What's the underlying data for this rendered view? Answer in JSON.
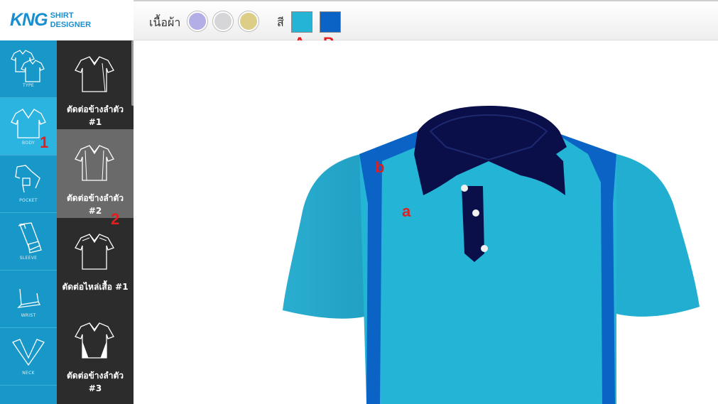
{
  "logo": {
    "mark": "KNG",
    "line1": "SHIRT",
    "line2": "DESIGNER"
  },
  "toolbar": {
    "fabric_label": "เนื้อผ้า",
    "fabric_swatches": [
      {
        "name": "purple",
        "color": "#b3aee6"
      },
      {
        "name": "grey",
        "color": "#d6d6d8"
      },
      {
        "name": "gold",
        "color": "#dcce86"
      }
    ],
    "color_label": "สี",
    "color_swatches": [
      {
        "marker": "A",
        "color": "#24b4d6"
      },
      {
        "marker": "B",
        "color": "#0b63c6"
      }
    ]
  },
  "categories": [
    {
      "label": "TYPE",
      "icon": "shirt-type-icon"
    },
    {
      "label": "BODY",
      "icon": "shirt-body-icon",
      "active": true,
      "marker": "1"
    },
    {
      "label": "POCKET",
      "icon": "pocket-icon"
    },
    {
      "label": "SLEEVE",
      "icon": "sleeve-icon"
    },
    {
      "label": "WRIST",
      "icon": "wrist-icon"
    },
    {
      "label": "NECK",
      "icon": "neck-icon"
    }
  ],
  "options": [
    {
      "line1": "ตัดต่อข้างลำตัว",
      "line2": "#1"
    },
    {
      "line1": "ตัดต่อข้างลำตัว",
      "line2": "#2",
      "active": true,
      "marker": "2"
    },
    {
      "line1": "ตัดต่อไหล่เสื้อ #1",
      "line2": ""
    },
    {
      "line1": "ตัดต่อข้างลำตัว",
      "line2": "#3"
    }
  ],
  "preview": {
    "marker_a": "a",
    "marker_b": "b",
    "colors": {
      "body": "#24b4d6",
      "panel": "#0b63c6",
      "collar": "#0a0f4a",
      "button": "#f0f0f0"
    }
  },
  "annotation_color": "#e41e1e"
}
